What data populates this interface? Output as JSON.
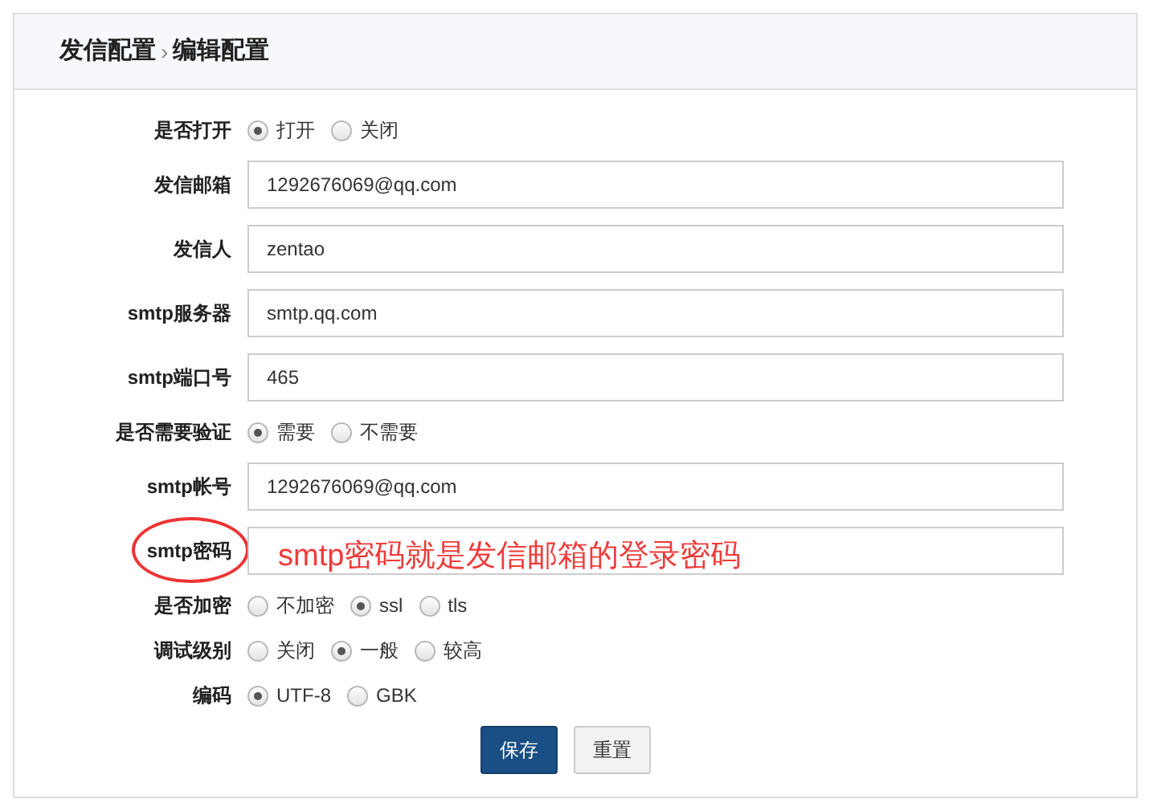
{
  "breadcrumb": {
    "parent": "发信配置",
    "separator": "›",
    "current": "编辑配置"
  },
  "fields": [
    {
      "kind": "radio",
      "label": "是否打开",
      "options": [
        {
          "label": "打开",
          "selected": true
        },
        {
          "label": "关闭",
          "selected": false
        }
      ]
    },
    {
      "kind": "text",
      "label": "发信邮箱",
      "value": "1292676069@qq.com"
    },
    {
      "kind": "text",
      "label": "发信人",
      "value": "zentao"
    },
    {
      "kind": "text",
      "label": "smtp服务器",
      "value": "smtp.qq.com"
    },
    {
      "kind": "text",
      "label": "smtp端口号",
      "value": "465"
    },
    {
      "kind": "radio",
      "label": "是否需要验证",
      "options": [
        {
          "label": "需要",
          "selected": true
        },
        {
          "label": "不需要",
          "selected": false
        }
      ]
    },
    {
      "kind": "text",
      "label": "smtp帐号",
      "value": "1292676069@qq.com"
    },
    {
      "kind": "text",
      "label": "smtp密码",
      "circled": true,
      "annotation": "smtp密码就是发信邮箱的登录密码"
    },
    {
      "kind": "radio",
      "label": "是否加密",
      "options": [
        {
          "label": "不加密",
          "selected": false
        },
        {
          "label": "ssl",
          "selected": true
        },
        {
          "label": "tls",
          "selected": false
        }
      ]
    },
    {
      "kind": "radio",
      "label": "调试级别",
      "options": [
        {
          "label": "关闭",
          "selected": false
        },
        {
          "label": "一般",
          "selected": true
        },
        {
          "label": "较高",
          "selected": false
        }
      ]
    },
    {
      "kind": "radio",
      "label": "编码",
      "options": [
        {
          "label": "UTF-8",
          "selected": true
        },
        {
          "label": "GBK",
          "selected": false
        }
      ]
    }
  ],
  "buttons": [
    {
      "kind": "primary",
      "label": "保存"
    },
    {
      "kind": "default",
      "label": "重置"
    }
  ]
}
